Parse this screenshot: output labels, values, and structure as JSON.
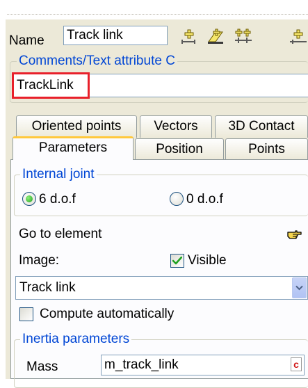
{
  "name_row": {
    "label": "Name",
    "value": "Track link",
    "tool_icons": [
      "add-point-icon",
      "edit-point-icon",
      "add-multiple-icon",
      "add-line-icon"
    ]
  },
  "comments": {
    "legend": "Comments/Text attribute C",
    "value": "TrackLink"
  },
  "tabs": {
    "row1": [
      "Oriented points",
      "Vectors",
      "3D Contact"
    ],
    "row2": [
      "Parameters",
      "Position",
      "Points"
    ],
    "active": "Parameters"
  },
  "internal_joint": {
    "legend": "Internal joint",
    "options": [
      "6 d.o.f",
      "0 d.o.f"
    ],
    "selected": "6 d.o.f"
  },
  "goto": {
    "label": "Go to element",
    "icon": "pointing-hand-icon"
  },
  "image": {
    "label": "Image:",
    "visible_label": "Visible",
    "visible_checked": true,
    "selected": "Track link"
  },
  "compute": {
    "label": "Compute automatically",
    "checked": false
  },
  "inertia": {
    "legend": "Inertia parameters",
    "mass_label": "Mass",
    "mass_value": "m_track_link",
    "c_badge": "c"
  },
  "colors": {
    "legend_blue": "#0046d5",
    "highlight_red": "#e8202a",
    "tab_accent": "#ffc83c",
    "panel_bg": "#ece9d8"
  }
}
